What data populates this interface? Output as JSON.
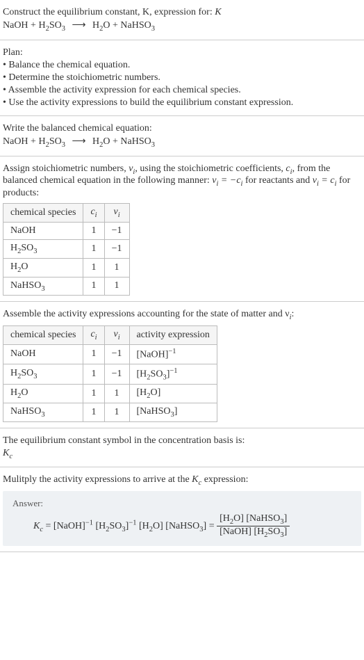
{
  "prompt": {
    "line1": "Construct the equilibrium constant, K, expression for:",
    "eq_lhs1": "NaOH + H",
    "eq_lhs2": "SO",
    "eq_rhs1": "H",
    "eq_rhs2": "O + NaHSO",
    "arrow": "⟶"
  },
  "plan": {
    "heading": "Plan:",
    "b1": "• Balance the chemical equation.",
    "b2": "• Determine the stoichiometric numbers.",
    "b3": "• Assemble the activity expression for each chemical species.",
    "b4": "• Use the activity expressions to build the equilibrium constant expression."
  },
  "balanced": {
    "heading": "Write the balanced chemical equation:"
  },
  "assign": {
    "text1": "Assign stoichiometric numbers, ",
    "text2": ", using the stoichiometric coefficients, ",
    "text3": ", from the balanced chemical equation in the following manner: ",
    "text4": " for reactants and ",
    "text5": " for products:",
    "nu": "ν",
    "c": "c",
    "i": "i",
    "eq1a": "ν",
    "eq1b": " = −c",
    "eq2a": "ν",
    "eq2b": " = c",
    "th1": "chemical species",
    "th2": "c",
    "th3": "ν",
    "rows": [
      {
        "sp": "NaOH",
        "c": "1",
        "v": "−1"
      },
      {
        "sp": "H2SO3",
        "c": "1",
        "v": "−1"
      },
      {
        "sp": "H2O",
        "c": "1",
        "v": "1"
      },
      {
        "sp": "NaHSO3",
        "c": "1",
        "v": "1"
      }
    ]
  },
  "assemble": {
    "heading": "Assemble the activity expressions accounting for the state of matter and ν",
    "colon": ":",
    "th4": "activity expression",
    "rows": [
      {
        "sp": "NaOH",
        "c": "1",
        "v": "−1",
        "act": "[NaOH]^-1"
      },
      {
        "sp": "H2SO3",
        "c": "1",
        "v": "−1",
        "act": "[H2SO3]^-1"
      },
      {
        "sp": "H2O",
        "c": "1",
        "v": "1",
        "act": "[H2O]"
      },
      {
        "sp": "NaHSO3",
        "c": "1",
        "v": "1",
        "act": "[NaHSO3]"
      }
    ]
  },
  "symbol": {
    "line1": "The equilibrium constant symbol in the concentration basis is:",
    "kc": "K",
    "c": "c"
  },
  "multiply": {
    "line1": "Mulitply the activity expressions to arrive at the ",
    "line2": " expression:"
  },
  "answer": {
    "label": "Answer:",
    "kc": "K",
    "c": "c",
    "eq": " = [NaOH]",
    "neg1": "−1",
    "sp1": " [H",
    "sp2": "SO",
    "sp3": "]",
    "sp4": " [H",
    "sp5": "O] [NaHSO",
    "sp6": "] = ",
    "num1": "[H",
    "num2": "O] [NaHSO",
    "num3": "]",
    "den1": "[NaOH] [H",
    "den2": "SO",
    "den3": "]"
  },
  "sub2": "2",
  "sub3": "3"
}
